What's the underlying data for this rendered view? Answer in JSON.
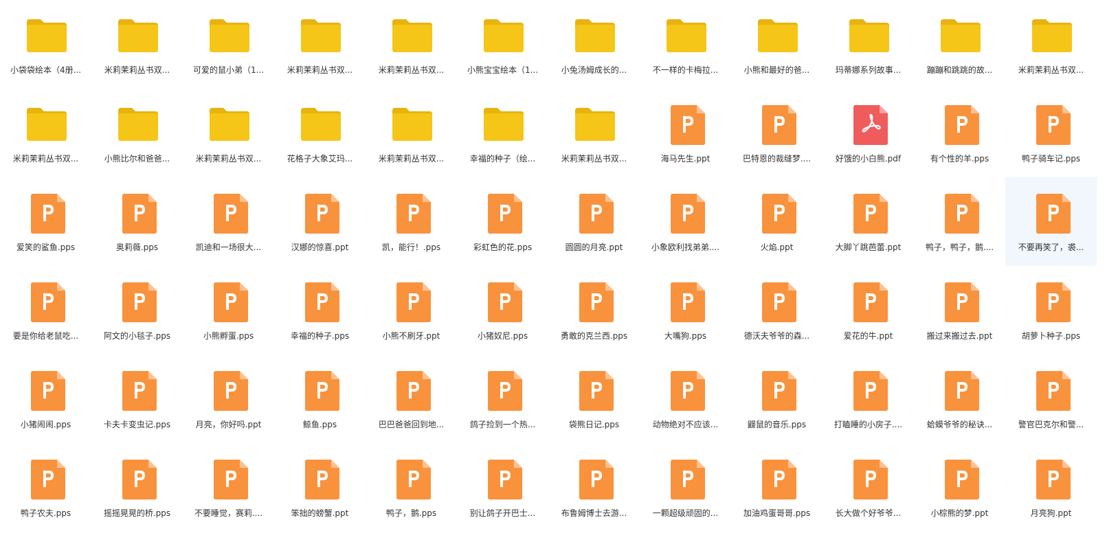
{
  "colors": {
    "folder": "#f5c518",
    "folder_tab": "#e8b30e",
    "ppt": "#f9923c",
    "ppt_fold": "#fcc190",
    "pdf": "#f05c5c",
    "pdf_fold": "#f8a0a0",
    "selected_bg": "#f1f7fd",
    "label_text": "#333333"
  },
  "items": [
    {
      "label": "小袋袋绘本（4册...",
      "icon": "folder-icon"
    },
    {
      "label": "米莉茉莉丛书双...",
      "icon": "folder-icon"
    },
    {
      "label": "可爱的鼠小弟（1...",
      "icon": "folder-icon"
    },
    {
      "label": "米莉茉莉丛书双...",
      "icon": "folder-icon"
    },
    {
      "label": "米莉茉莉丛书双...",
      "icon": "folder-icon"
    },
    {
      "label": "小熊宝宝绘本（1...",
      "icon": "folder-icon"
    },
    {
      "label": "小兔汤姆成长的...",
      "icon": "folder-icon"
    },
    {
      "label": "不一样的卡梅拉...",
      "icon": "folder-icon"
    },
    {
      "label": "小熊和最好的爸...",
      "icon": "folder-icon"
    },
    {
      "label": "玛蒂娜系列故事...",
      "icon": "folder-icon"
    },
    {
      "label": "蹦蹦和跳跳的故...",
      "icon": "folder-icon"
    },
    {
      "label": "米莉茉莉丛书双...",
      "icon": "folder-icon"
    },
    {
      "label": "米莉茉莉丛书双...",
      "icon": "folder-icon"
    },
    {
      "label": "小熊比尔和爸爸...",
      "icon": "folder-icon"
    },
    {
      "label": "米莉茉莉丛书双...",
      "icon": "folder-icon"
    },
    {
      "label": "花格子大象艾玛...",
      "icon": "folder-icon"
    },
    {
      "label": "米莉茉莉丛书双...",
      "icon": "folder-icon"
    },
    {
      "label": "幸福的种子（绘...",
      "icon": "folder-icon"
    },
    {
      "label": "米莉茉莉丛书双...",
      "icon": "folder-icon"
    },
    {
      "label": "海马先生.ppt",
      "icon": "ppt-icon"
    },
    {
      "label": "巴特恩的裁缝梦....",
      "icon": "ppt-icon"
    },
    {
      "label": "好饿的小白熊.pdf",
      "icon": "pdf-icon"
    },
    {
      "label": "有个性的羊.pps",
      "icon": "ppt-icon"
    },
    {
      "label": "鸭子骑车记.pps",
      "icon": "ppt-icon"
    },
    {
      "label": "爱笑的鲨鱼.pps",
      "icon": "ppt-icon"
    },
    {
      "label": "奥莉薇.pps",
      "icon": "ppt-icon"
    },
    {
      "label": "凯迪和一场很大...",
      "icon": "ppt-icon"
    },
    {
      "label": "汉娜的惊喜.ppt",
      "icon": "ppt-icon"
    },
    {
      "label": "凯，能行！.pps",
      "icon": "ppt-icon"
    },
    {
      "label": "彩虹色的花.pps",
      "icon": "ppt-icon"
    },
    {
      "label": "圆圆的月亮.ppt",
      "icon": "ppt-icon"
    },
    {
      "label": "小象欧利找弟弟....",
      "icon": "ppt-icon"
    },
    {
      "label": "火焰.ppt",
      "icon": "ppt-icon"
    },
    {
      "label": "大脚丫跳芭蕾.ppt",
      "icon": "ppt-icon"
    },
    {
      "label": "鸭子，鸭子，鹅....",
      "icon": "ppt-icon"
    },
    {
      "label": "不要再笑了，裘...",
      "icon": "ppt-icon",
      "selected": true
    },
    {
      "label": "要是你给老鼠吃...",
      "icon": "ppt-icon"
    },
    {
      "label": "阿文的小毯子.pps",
      "icon": "ppt-icon"
    },
    {
      "label": "小熊孵蛋.pps",
      "icon": "ppt-icon"
    },
    {
      "label": "幸福的种子.pps",
      "icon": "ppt-icon"
    },
    {
      "label": "小熊不刷牙.ppt",
      "icon": "ppt-icon"
    },
    {
      "label": "小猪奴尼.pps",
      "icon": "ppt-icon"
    },
    {
      "label": "勇敢的克兰西.pps",
      "icon": "ppt-icon"
    },
    {
      "label": "大嘴狗.pps",
      "icon": "ppt-icon"
    },
    {
      "label": "德沃夫爷爷的森...",
      "icon": "ppt-icon"
    },
    {
      "label": "爱花的牛.ppt",
      "icon": "ppt-icon"
    },
    {
      "label": "搬过来搬过去.ppt",
      "icon": "ppt-icon"
    },
    {
      "label": "胡萝卜种子.pps",
      "icon": "ppt-icon"
    },
    {
      "label": "小猪闹闹.pps",
      "icon": "ppt-icon"
    },
    {
      "label": "卡夫卡变虫记.pps",
      "icon": "ppt-icon"
    },
    {
      "label": "月亮，你好吗.ppt",
      "icon": "ppt-icon"
    },
    {
      "label": "鲸鱼.pps",
      "icon": "ppt-icon"
    },
    {
      "label": "巴巴爸爸回到地...",
      "icon": "ppt-icon"
    },
    {
      "label": "鸽子捡到一个热...",
      "icon": "ppt-icon"
    },
    {
      "label": "袋熊日记.pps",
      "icon": "ppt-icon"
    },
    {
      "label": "动物绝对不应该...",
      "icon": "ppt-icon"
    },
    {
      "label": "鼹鼠的音乐.pps",
      "icon": "ppt-icon"
    },
    {
      "label": "打瞌睡的小房子....",
      "icon": "ppt-icon"
    },
    {
      "label": "蛤蟆爷爷的秘诀...",
      "icon": "ppt-icon"
    },
    {
      "label": "警官巴克尔和警...",
      "icon": "ppt-icon"
    },
    {
      "label": "鸭子农夫.pps",
      "icon": "ppt-icon"
    },
    {
      "label": "摇摇晃晃的桥.pps",
      "icon": "ppt-icon"
    },
    {
      "label": "不要睡觉，赛莉....",
      "icon": "ppt-icon"
    },
    {
      "label": "笨拙的螃蟹.ppt",
      "icon": "ppt-icon"
    },
    {
      "label": "鸭子，鹅.pps",
      "icon": "ppt-icon"
    },
    {
      "label": "别让鸽子开巴士...",
      "icon": "ppt-icon"
    },
    {
      "label": "布鲁姆博士去游...",
      "icon": "ppt-icon"
    },
    {
      "label": "一颗超级顽固的...",
      "icon": "ppt-icon"
    },
    {
      "label": "加油鸡蛋哥哥.pps",
      "icon": "ppt-icon"
    },
    {
      "label": "长大做个好爷爷...",
      "icon": "ppt-icon"
    },
    {
      "label": "小棕熊的梦.ppt",
      "icon": "ppt-icon"
    },
    {
      "label": "月亮狗.ppt",
      "icon": "ppt-icon"
    }
  ]
}
